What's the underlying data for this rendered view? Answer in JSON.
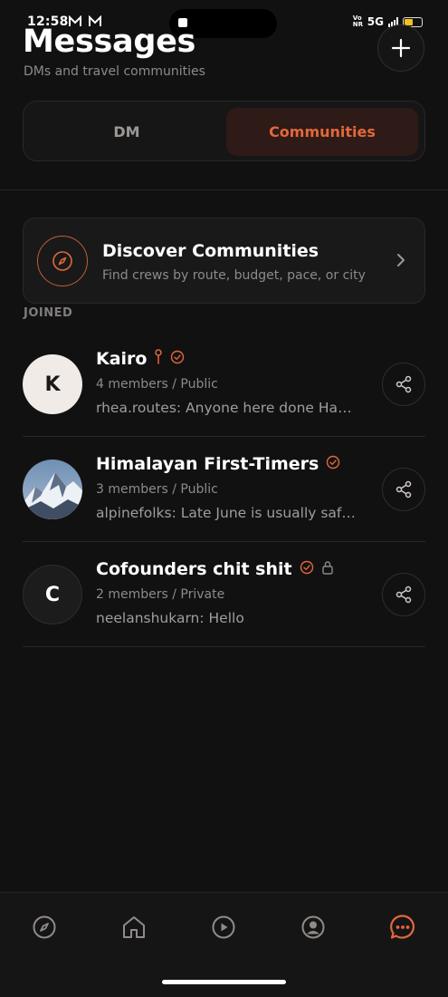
{
  "status": {
    "time": "12:58",
    "left_icons": "M M",
    "network": "5G",
    "network_sub": "VoNR",
    "battery_level": 0.45
  },
  "header": {
    "title": "Messages",
    "subtitle": "DMs and travel communities"
  },
  "tabs": [
    {
      "label": "DM",
      "active": false
    },
    {
      "label": "Communities",
      "active": true
    }
  ],
  "discover": {
    "title": "Discover Communities",
    "subtitle": "Find crews by route, budget, pace, or city"
  },
  "section_label": "JOINED",
  "communities": [
    {
      "name": "Kairo",
      "initial": "K",
      "meta": "4 members / Public",
      "preview": "rhea.routes: Anyone here done Hampi in monsoon?",
      "verified": true,
      "pinned": true,
      "private": false
    },
    {
      "name": "Himalayan First-Timers",
      "initial": "",
      "meta": "3 members / Public",
      "preview": "alpinefolks: Late June is usually safe for beginners",
      "verified": true,
      "pinned": false,
      "private": false
    },
    {
      "name": "Cofounders chit shit",
      "initial": "C",
      "meta": "2 members / Private",
      "preview": "neelanshukarn: Hello",
      "verified": true,
      "pinned": false,
      "private": true
    }
  ],
  "nav": [
    "compass-icon",
    "home-icon",
    "play-icon",
    "profile-icon",
    "chat-icon"
  ],
  "colors": {
    "accent": "#e1683c",
    "background": "#121112",
    "surface": "#1a1919"
  }
}
